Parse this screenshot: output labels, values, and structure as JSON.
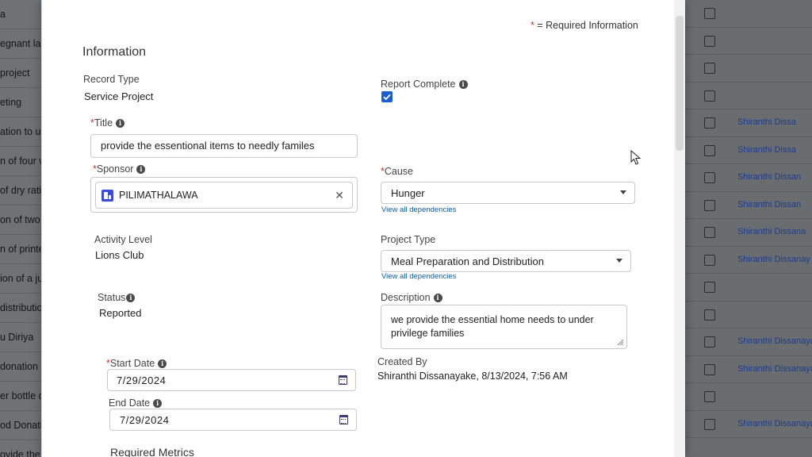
{
  "left_list": [
    "a",
    "egnant la",
    "project",
    "eting",
    "ation to un",
    "n of four wh",
    "of dry ration",
    "on of two dict",
    "n of printer to",
    "ion of a jucky",
    "distribution",
    "u Diriya",
    "donation to lad",
    "er bottle donatio",
    "od Donation",
    "ovide the short m"
  ],
  "right_list": [
    "",
    "",
    "",
    "",
    "Shiranthi Dissa",
    "Shiranthi Dissa",
    "Shiranthi Dissan",
    "Shiranthi Dissan",
    "Shiranthi Dissana",
    "Shiranthi Dissanay",
    "",
    "",
    "Shiranthi Dissanayak",
    "Shiranthi Dissanayak",
    "",
    "Shiranthi Dissanayake"
  ],
  "form": {
    "required_note": "= Required Information",
    "required_star": "*",
    "section_title": "Information",
    "record_type": {
      "label": "Record Type",
      "value": "Service Project"
    },
    "report_complete": {
      "label": "Report Complete",
      "checked": true
    },
    "title": {
      "label": "Title",
      "value": "provide the essentional items to needly familes"
    },
    "sponsor": {
      "label": "Sponsor",
      "value": "PILIMATHALAWA"
    },
    "cause": {
      "label": "Cause",
      "value": "Hunger",
      "dependencies_link": "View all dependencies"
    },
    "activity_level": {
      "label": "Activity Level",
      "value": "Lions Club"
    },
    "project_type": {
      "label": "Project Type",
      "value": "Meal Preparation and Distribution",
      "dependencies_link": "View all dependencies"
    },
    "status": {
      "label": "Status",
      "value": "Reported"
    },
    "description": {
      "label": "Description",
      "value": "we provide the essential home needs to under privilege families"
    },
    "start_date": {
      "label": "Start Date",
      "value": "7/29/2024"
    },
    "created_by": {
      "label": "Created By",
      "value": "Shiranthi Dissanayake, 8/13/2024, 7:56 AM"
    },
    "end_date": {
      "label": "End Date",
      "value": "7/29/2024"
    },
    "required_metrics": "Required Metrics"
  },
  "colors": {
    "accent": "#1b5fd0",
    "required": "#c23934",
    "link": "#0b5cab",
    "sponsor_icon": "#3a4ad6"
  },
  "icons": [
    "info-icon",
    "checkbox-checked-icon",
    "account-icon",
    "clear-icon",
    "chevron-down-icon",
    "calendar-icon",
    "resize-handle-icon",
    "mouse-cursor-icon"
  ]
}
